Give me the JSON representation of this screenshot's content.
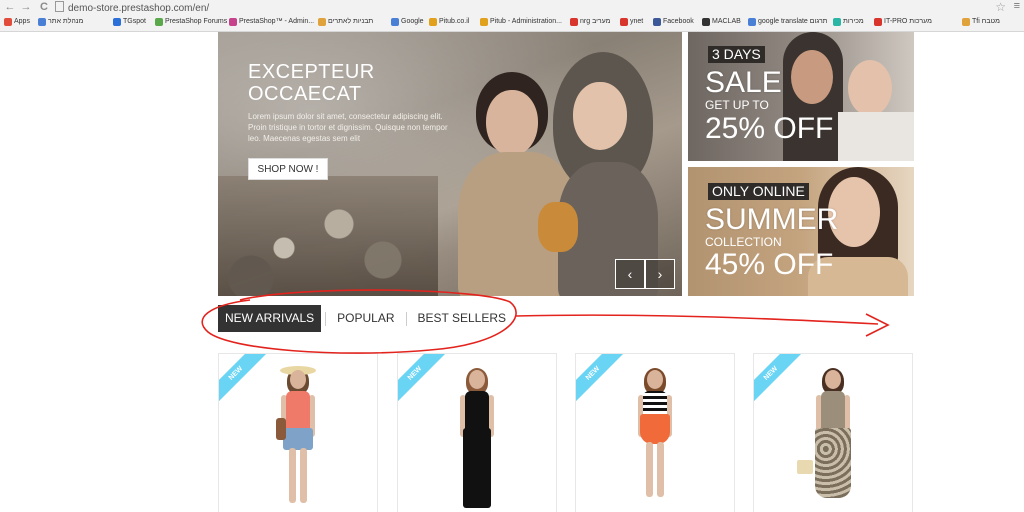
{
  "browser": {
    "url": "demo-store.prestashop.com/en/",
    "back_glyph": "←",
    "forward_glyph": "→",
    "reload_glyph": "C",
    "star_glyph": "☆",
    "menu_glyph": "≡",
    "bookmarks": [
      {
        "label": "Apps",
        "color": "#e24c3b"
      },
      {
        "label": "מנהלת אתר",
        "color": "#4a7fd6"
      },
      {
        "label": "TGspot",
        "color": "#2b6fd9"
      },
      {
        "label": "PrestaShop Forums",
        "color": "#5aa84a"
      },
      {
        "label": "PrestaShop™ - Admin...",
        "color": "#c6428a"
      },
      {
        "label": "תבניות לאתרים",
        "color": "#e0a23a"
      },
      {
        "label": "Google",
        "color": "#4a7fd6"
      },
      {
        "label": "Pitub.co.il",
        "color": "#e2a11c"
      },
      {
        "label": "Pitub - Administration...",
        "color": "#e2a11c"
      },
      {
        "label": "nrg מעריב",
        "color": "#d8352d"
      },
      {
        "label": "ynet",
        "color": "#d8352d"
      },
      {
        "label": "Facebook",
        "color": "#3b5998"
      },
      {
        "label": "MACLAB",
        "color": "#333333"
      },
      {
        "label": "google translate תרגום",
        "color": "#4a7fd6"
      },
      {
        "label": "מכירות",
        "color": "#2ab5a5"
      },
      {
        "label": "IT-PRO מערכות",
        "color": "#d8352d"
      },
      {
        "label": "Tfi מטבח",
        "color": "#e0a23a"
      }
    ]
  },
  "slider": {
    "title_line1": "EXCEPTEUR",
    "title_line2": "OCCAECAT",
    "text": "Lorem ipsum dolor sit amet, consectetur adipiscing elit. Proin tristique in tortor et dignissim. Quisque non tempor leo. Maecenas egestas sem elit",
    "button": "SHOP NOW !",
    "prev_glyph": "‹",
    "next_glyph": "›"
  },
  "banners": [
    {
      "tag": "3 DAYS",
      "headline": "SALE",
      "subline": "GET UP TO",
      "offer": "25% OFF"
    },
    {
      "tag": "ONLY ONLINE",
      "headline": "SUMMER",
      "subline": "COLLECTION",
      "offer": "45% OFF"
    }
  ],
  "tabs": [
    {
      "label": "NEW ARRIVALS",
      "active": true
    },
    {
      "label": "POPULAR",
      "active": false
    },
    {
      "label": "BEST SELLERS",
      "active": false
    }
  ],
  "products": [
    {
      "badge": "NEW"
    },
    {
      "badge": "NEW"
    },
    {
      "badge": "NEW"
    },
    {
      "badge": "NEW"
    }
  ],
  "colors": {
    "tab_active_bg": "#333333",
    "ribbon": "#6ad4f5",
    "annotation": "#e3231d"
  }
}
